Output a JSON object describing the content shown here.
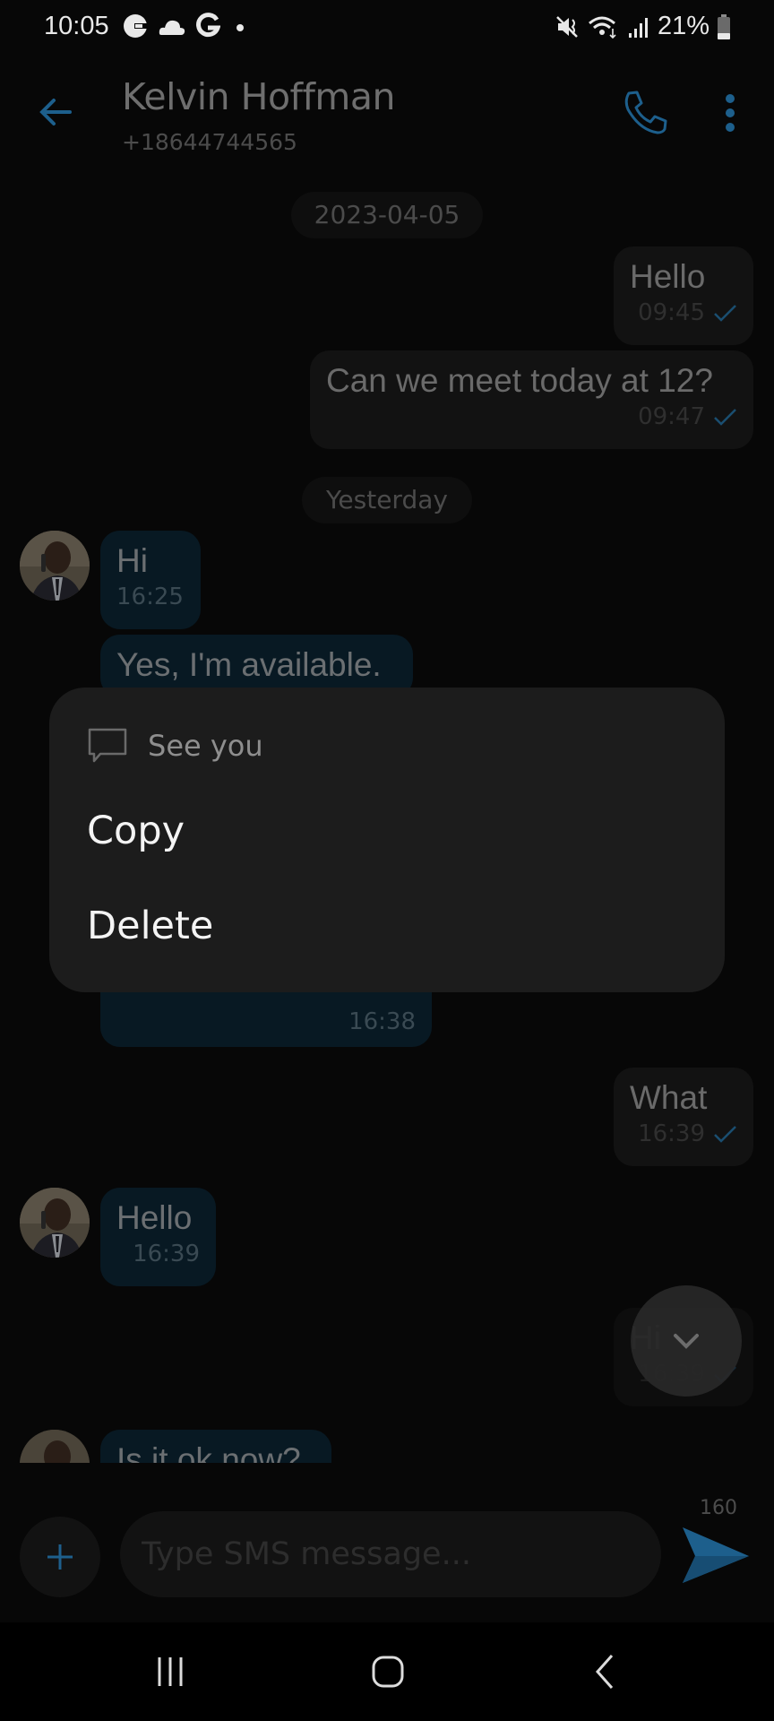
{
  "status_bar": {
    "time": "10:05",
    "notification_icons": [
      "google-icon",
      "cloud-icon",
      "google-g-icon",
      "dot-icon"
    ],
    "battery": "21%",
    "right_icons": [
      "mute-icon",
      "wifi-icon",
      "signal-icon",
      "battery-icon"
    ]
  },
  "header": {
    "contact_name": "Kelvin Hoffman",
    "phone_number": "+18644744565",
    "back_icon": "arrow-left-icon",
    "call_icon": "phone-icon",
    "more_icon": "more-vertical-icon"
  },
  "conversation": {
    "date_chips": [
      "2023-04-05",
      "Yesterday"
    ],
    "messages": [
      {
        "direction": "outgoing",
        "text": "Hello",
        "time": "09:45",
        "status": "sent"
      },
      {
        "direction": "outgoing",
        "text": "Can we meet today at 12?",
        "time": "09:47",
        "status": "sent"
      },
      {
        "direction": "incoming",
        "text": "Hi",
        "time": "16:25"
      },
      {
        "direction": "incoming",
        "text": "Yes, I'm available.",
        "time": ""
      },
      {
        "direction": "incoming",
        "text": "",
        "time": "16:38"
      },
      {
        "direction": "outgoing",
        "text": "What",
        "time": "16:39",
        "status": "sent"
      },
      {
        "direction": "incoming",
        "text": "Hello",
        "time": "16:39"
      },
      {
        "direction": "outgoing",
        "text": "Hi",
        "time": "16:39",
        "status": "sent"
      },
      {
        "direction": "incoming",
        "text": "Is it ok now?",
        "time": ""
      }
    ]
  },
  "context_menu": {
    "preview_text": "See you",
    "items": [
      {
        "label": "Copy"
      },
      {
        "label": "Delete"
      }
    ]
  },
  "composer": {
    "placeholder": "Type SMS message...",
    "value": "",
    "char_count": "160"
  },
  "colors": {
    "accent": "#1d5f8c",
    "incoming_bubble": "#081923",
    "outgoing_bubble": "#121212",
    "menu_background": "#1c1c1c"
  }
}
